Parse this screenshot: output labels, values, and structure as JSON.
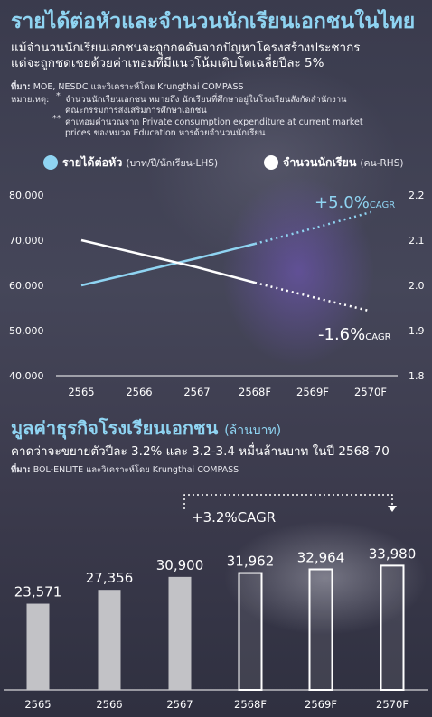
{
  "header": {
    "title": "รายได้ต่อหัวและจำนวนนักเรียนเอกชนในไทย",
    "subtitle_line1": "แม้จำนวนนักเรียนเอกชนจะถูกกดดันจากปัญหาโครงสร้างประชากร",
    "subtitle_line2": "แต่จะถูกชดเชยด้วยค่าเทอมที่มีแนวโน้มเติบโตเฉลี่ยปีละ 5%",
    "source_label": "ที่มา:",
    "source_text": "MOE, NESDC และวิเคราะห์โดย Krungthai COMPASS",
    "note_label": "หมายเหตุ:",
    "note1_marker": "*",
    "note1_line1": "จำนวนนักเรียนเอกชน หมายถึง นักเรียนที่ศึกษาอยู่ในโรงเรียนสังกัดสำนักงาน",
    "note1_line2": "คณะกรรมการส่งเสริมการศึกษาเอกชน",
    "note2_marker": "**",
    "note2_line1": "ค่าเทอมคำนวณจาก Private consumption expenditure at current market",
    "note2_line2": "prices ของหมวด Education หารด้วยจำนวนนักเรียน"
  },
  "legend": {
    "item1_label": "รายได้ต่อหัว",
    "item1_unit": "(บาท/ปี/นักเรียน-LHS)",
    "item1_color": "#8fd4f2",
    "item2_label": "จำนวนนักเรียน",
    "item2_unit": "(คน-RHS)",
    "item2_color": "#ffffff"
  },
  "section2": {
    "title": "มูลค่าธุรกิจโรงเรียนเอกชน",
    "unit": "(ล้านบาท)",
    "subtitle": "คาดว่าจะขยายตัวปีละ 3.2% และ 3.2-3.4 หมื่นล้านบาท ในปี 2568-70",
    "source_label": "ที่มา:",
    "source_text": "BOL-ENLITE และวิเคราะห์โดย Krungthai COMPASS"
  },
  "chart_data": [
    {
      "type": "line",
      "categories": [
        "2565",
        "2566",
        "2567",
        "2568F",
        "2569F",
        "2570F"
      ],
      "forecast_from": "2568F",
      "y_left": {
        "ticks": [
          "40,000",
          "50,000",
          "60,000",
          "70,000",
          "80,000"
        ],
        "ylim": [
          40000,
          80000
        ]
      },
      "y_right": {
        "ticks": [
          "1.8",
          "1.9",
          "2.0",
          "2.1",
          "2.2"
        ],
        "ylim": [
          1.8,
          2.2
        ]
      },
      "series": [
        {
          "name": "รายได้ต่อหัว",
          "axis": "left",
          "color": "#8fd4f2",
          "values": [
            60000,
            63000,
            66000,
            69200,
            72600,
            76200
          ]
        },
        {
          "name": "จำนวนนักเรียน",
          "axis": "right",
          "color": "#ffffff",
          "values": [
            2.1,
            2.07,
            2.04,
            2.006,
            1.974,
            1.943
          ]
        }
      ],
      "annotations": [
        {
          "value": "+5.0%",
          "suffix": "CAGR"
        },
        {
          "value": "-1.6%",
          "suffix": "CAGR"
        }
      ],
      "grid": false
    },
    {
      "type": "bar",
      "categories": [
        "2565",
        "2566",
        "2567",
        "2568F",
        "2569F",
        "2570F"
      ],
      "values": [
        23571,
        27356,
        30900,
        31962,
        32964,
        33980
      ],
      "value_labels": [
        "23,571",
        "27,356",
        "30,900",
        "31,962",
        "32,964",
        "33,980"
      ],
      "forecast_from": "2568F",
      "ylim": [
        0,
        40000
      ],
      "annotation": "+3.2%CAGR"
    }
  ]
}
